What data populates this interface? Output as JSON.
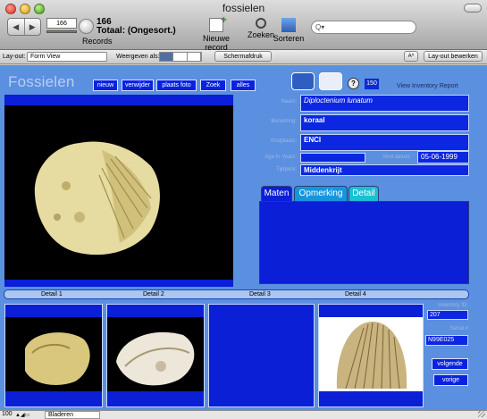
{
  "window": {
    "title": "fossielen"
  },
  "toolbar": {
    "record_number": "166",
    "record_count": "166",
    "record_total": "Totaal: (Ongesort.)",
    "records_label": "Records",
    "new_record_label": "Nieuwe record",
    "find_label": "Zoeken",
    "sort_label": "Sorteren",
    "search_placeholder": "Q▾"
  },
  "layout_bar": {
    "layout_label": "Lay-out:",
    "layout_value": "Form View",
    "view_as_label": "Weergeven als:",
    "print_preview_label": "Schermafdruk",
    "aa_label": "Aᴬ",
    "edit_layout_label": "Lay-out bewerken"
  },
  "content": {
    "app_title": "Fossielen",
    "buttons": {
      "nieuw": "nieuw",
      "verwijder": "verwijder",
      "plaats_foto": "plaats foto",
      "zoek": "Zoek",
      "alles": "alles"
    },
    "help_symbol": "?",
    "record_badge": "150",
    "view_report": "View Inventory Report",
    "fields": {
      "naam_label": "Naam:",
      "naam_value": "Diploctenium lunatum",
      "benaming_label": "Benaming:",
      "benaming_value": "koraal",
      "vindplaats_label": "Vindplaats:",
      "vindplaats_value": "ENCI",
      "age_label": "Age In Years:",
      "age_value": "",
      "vind_datum_label": "Vind datum:",
      "vind_datum_value": "05-06-1999",
      "tijdperk_label": "Tijdperk:",
      "tijdperk_value": "Middenkrijt"
    },
    "subtabs": [
      "Maten",
      "Opmerking",
      "Detail"
    ],
    "detail_strip": [
      "Detail 1",
      "Detail 2",
      "Detail 3",
      "Detail 4"
    ],
    "inventory_id_label": "Inventory ID:",
    "inventory_id_value": "207",
    "serial_label": "Serial #",
    "serial_value": "N99E025",
    "volgende_label": "volgende",
    "vorige_label": "vorige"
  },
  "statusbar": {
    "zoom": "100",
    "mode": "Bladeren"
  },
  "colors": {
    "background": "#5b8fe0",
    "field_blue": "#0c27e2",
    "tab_maten": "#0a1fd6",
    "tab_opmerking": "#1596dc",
    "tab_detail": "#19c1d2"
  },
  "icons": [
    "back-arrow-icon",
    "forward-arrow-icon",
    "new-record-icon",
    "magnifier-icon",
    "sort-icon",
    "search-icon",
    "form-view-icon",
    "list-view-icon",
    "table-view-icon",
    "help-icon",
    "resize-grip-icon"
  ]
}
